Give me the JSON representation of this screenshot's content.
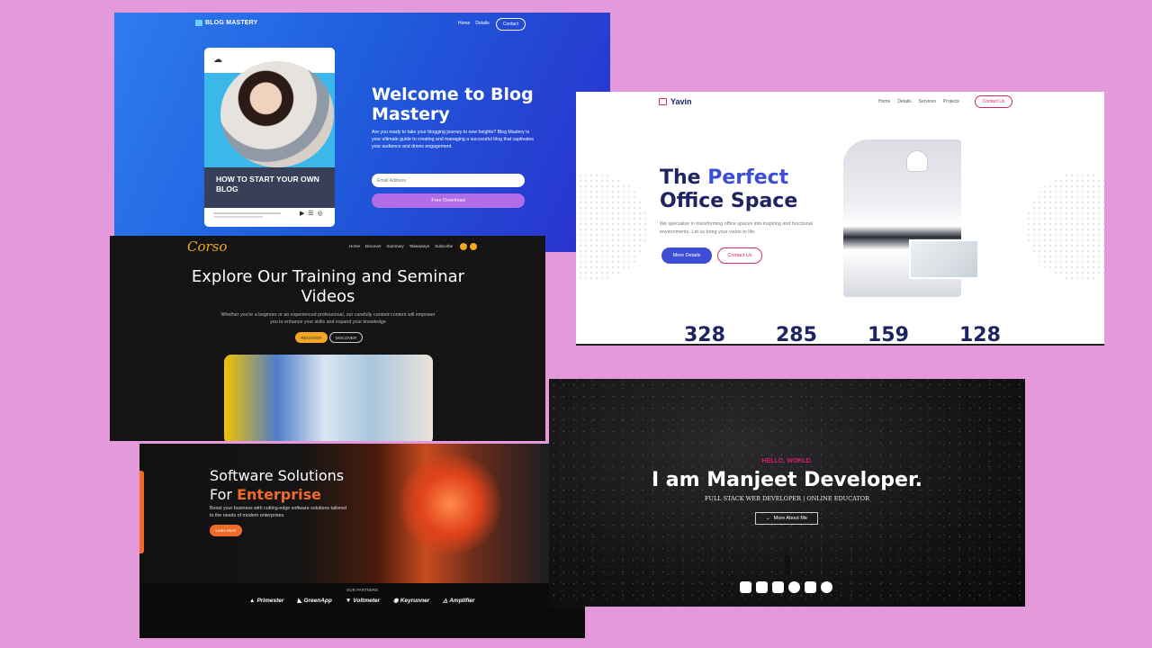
{
  "blog": {
    "logo": "BLOG MASTERY",
    "nav": [
      "Home",
      "Details"
    ],
    "contact": "Contact",
    "card_title": "HOW TO START YOUR OWN BLOG",
    "heading": "Welcome to Blog Mastery",
    "description": "Are you ready to take your blogging journey to new heights? Blog Mastery is your ultimate guide to creating and managing a successful blog that captivates your audience and drives engagement.",
    "email_placeholder": "Email Address",
    "download": "Free Download"
  },
  "yavin": {
    "logo": "Yavin",
    "nav": [
      "Home",
      "Details",
      "Services",
      "Projects"
    ],
    "contact": "Contact Us",
    "heading_1": "The ",
    "heading_hl": "Perfect",
    "heading_2": "Office Space",
    "description": "We specialize in transforming office spaces into inspiring and functional environments. Let us bring your vision to life.",
    "more": "More Details",
    "contact_btn": "Contact Us",
    "stats": [
      "328",
      "285",
      "159",
      "128"
    ]
  },
  "corso": {
    "logo": "Corso",
    "nav": [
      "Home",
      "Discover",
      "Summary",
      "Takeaways",
      "Subscribe"
    ],
    "heading": "Explore Our Training and Seminar Videos",
    "description": "Whether you're a beginner or an experienced professional, our carefully curated content will empower you to enhance your skills and expand your knowledge",
    "register": "REGISTER",
    "discover": "DISCOVER"
  },
  "enterprise": {
    "heading_1": "Software Solutions",
    "heading_2": "For ",
    "heading_hl": "Enterprise",
    "description": "Boost your business with cutting-edge software solutions tailored to the needs of modern enterprises.",
    "button": "Learn More",
    "partners_label": "OUR PARTNERS",
    "partners": [
      "Primester",
      "GreenApp",
      "Voltmeter",
      "Keyrunner",
      "Amplifier"
    ]
  },
  "developer": {
    "hello": "HELLO, WORLD.",
    "heading": "I am Manjeet Developer.",
    "subtitle": "FULL STACK WEB DEVELOPER | ONLINE EDUCATOR",
    "button": "More About Me",
    "socials": [
      "twitter-icon",
      "instagram-icon",
      "linkedin-icon",
      "facebook-icon",
      "youtube-icon",
      "github-icon"
    ]
  }
}
